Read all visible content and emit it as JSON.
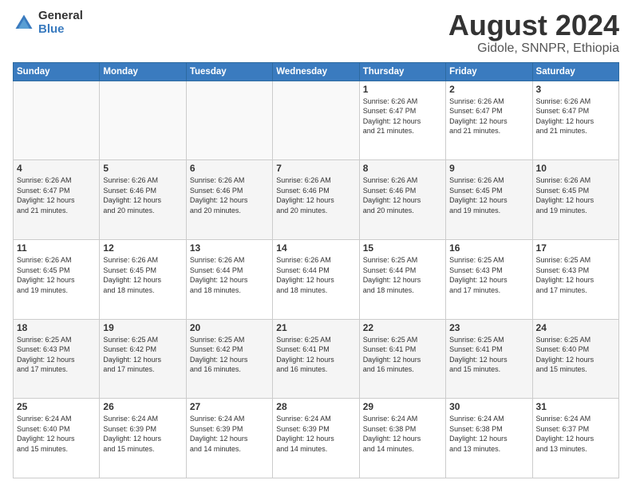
{
  "logo": {
    "general": "General",
    "blue": "Blue"
  },
  "title": "August 2024",
  "subtitle": "Gidole, SNNPR, Ethiopia",
  "days_of_week": [
    "Sunday",
    "Monday",
    "Tuesday",
    "Wednesday",
    "Thursday",
    "Friday",
    "Saturday"
  ],
  "weeks": [
    [
      {
        "day": "",
        "info": ""
      },
      {
        "day": "",
        "info": ""
      },
      {
        "day": "",
        "info": ""
      },
      {
        "day": "",
        "info": ""
      },
      {
        "day": "1",
        "info": "Sunrise: 6:26 AM\nSunset: 6:47 PM\nDaylight: 12 hours\nand 21 minutes."
      },
      {
        "day": "2",
        "info": "Sunrise: 6:26 AM\nSunset: 6:47 PM\nDaylight: 12 hours\nand 21 minutes."
      },
      {
        "day": "3",
        "info": "Sunrise: 6:26 AM\nSunset: 6:47 PM\nDaylight: 12 hours\nand 21 minutes."
      }
    ],
    [
      {
        "day": "4",
        "info": "Sunrise: 6:26 AM\nSunset: 6:47 PM\nDaylight: 12 hours\nand 21 minutes."
      },
      {
        "day": "5",
        "info": "Sunrise: 6:26 AM\nSunset: 6:46 PM\nDaylight: 12 hours\nand 20 minutes."
      },
      {
        "day": "6",
        "info": "Sunrise: 6:26 AM\nSunset: 6:46 PM\nDaylight: 12 hours\nand 20 minutes."
      },
      {
        "day": "7",
        "info": "Sunrise: 6:26 AM\nSunset: 6:46 PM\nDaylight: 12 hours\nand 20 minutes."
      },
      {
        "day": "8",
        "info": "Sunrise: 6:26 AM\nSunset: 6:46 PM\nDaylight: 12 hours\nand 20 minutes."
      },
      {
        "day": "9",
        "info": "Sunrise: 6:26 AM\nSunset: 6:45 PM\nDaylight: 12 hours\nand 19 minutes."
      },
      {
        "day": "10",
        "info": "Sunrise: 6:26 AM\nSunset: 6:45 PM\nDaylight: 12 hours\nand 19 minutes."
      }
    ],
    [
      {
        "day": "11",
        "info": "Sunrise: 6:26 AM\nSunset: 6:45 PM\nDaylight: 12 hours\nand 19 minutes."
      },
      {
        "day": "12",
        "info": "Sunrise: 6:26 AM\nSunset: 6:45 PM\nDaylight: 12 hours\nand 18 minutes."
      },
      {
        "day": "13",
        "info": "Sunrise: 6:26 AM\nSunset: 6:44 PM\nDaylight: 12 hours\nand 18 minutes."
      },
      {
        "day": "14",
        "info": "Sunrise: 6:26 AM\nSunset: 6:44 PM\nDaylight: 12 hours\nand 18 minutes."
      },
      {
        "day": "15",
        "info": "Sunrise: 6:25 AM\nSunset: 6:44 PM\nDaylight: 12 hours\nand 18 minutes."
      },
      {
        "day": "16",
        "info": "Sunrise: 6:25 AM\nSunset: 6:43 PM\nDaylight: 12 hours\nand 17 minutes."
      },
      {
        "day": "17",
        "info": "Sunrise: 6:25 AM\nSunset: 6:43 PM\nDaylight: 12 hours\nand 17 minutes."
      }
    ],
    [
      {
        "day": "18",
        "info": "Sunrise: 6:25 AM\nSunset: 6:43 PM\nDaylight: 12 hours\nand 17 minutes."
      },
      {
        "day": "19",
        "info": "Sunrise: 6:25 AM\nSunset: 6:42 PM\nDaylight: 12 hours\nand 17 minutes."
      },
      {
        "day": "20",
        "info": "Sunrise: 6:25 AM\nSunset: 6:42 PM\nDaylight: 12 hours\nand 16 minutes."
      },
      {
        "day": "21",
        "info": "Sunrise: 6:25 AM\nSunset: 6:41 PM\nDaylight: 12 hours\nand 16 minutes."
      },
      {
        "day": "22",
        "info": "Sunrise: 6:25 AM\nSunset: 6:41 PM\nDaylight: 12 hours\nand 16 minutes."
      },
      {
        "day": "23",
        "info": "Sunrise: 6:25 AM\nSunset: 6:41 PM\nDaylight: 12 hours\nand 15 minutes."
      },
      {
        "day": "24",
        "info": "Sunrise: 6:25 AM\nSunset: 6:40 PM\nDaylight: 12 hours\nand 15 minutes."
      }
    ],
    [
      {
        "day": "25",
        "info": "Sunrise: 6:24 AM\nSunset: 6:40 PM\nDaylight: 12 hours\nand 15 minutes."
      },
      {
        "day": "26",
        "info": "Sunrise: 6:24 AM\nSunset: 6:39 PM\nDaylight: 12 hours\nand 15 minutes."
      },
      {
        "day": "27",
        "info": "Sunrise: 6:24 AM\nSunset: 6:39 PM\nDaylight: 12 hours\nand 14 minutes."
      },
      {
        "day": "28",
        "info": "Sunrise: 6:24 AM\nSunset: 6:39 PM\nDaylight: 12 hours\nand 14 minutes."
      },
      {
        "day": "29",
        "info": "Sunrise: 6:24 AM\nSunset: 6:38 PM\nDaylight: 12 hours\nand 14 minutes."
      },
      {
        "day": "30",
        "info": "Sunrise: 6:24 AM\nSunset: 6:38 PM\nDaylight: 12 hours\nand 13 minutes."
      },
      {
        "day": "31",
        "info": "Sunrise: 6:24 AM\nSunset: 6:37 PM\nDaylight: 12 hours\nand 13 minutes."
      }
    ]
  ]
}
